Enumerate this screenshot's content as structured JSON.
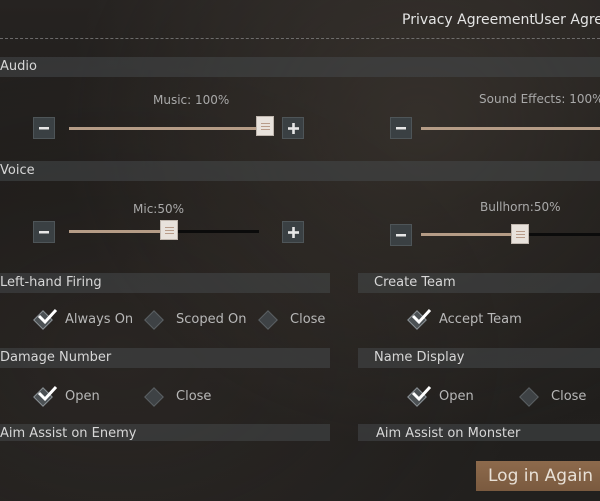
{
  "header": {
    "links": [
      "Privacy Agreement",
      "User Agree"
    ]
  },
  "sections": {
    "audio": "Audio",
    "voice": "Voice",
    "left_hand_firing": "Left-hand Firing",
    "create_team": "Create Team",
    "damage_number": "Damage Number",
    "name_display": "Name Display",
    "aim_assist_enemy": "Aim Assist on Enemy",
    "aim_assist_monster": "Aim Assist on Monster"
  },
  "sliders": {
    "music": {
      "label": "Music:  100%",
      "level": 1.0
    },
    "sound_effects": {
      "label": "Sound Effects:  100%",
      "level": 1.0
    },
    "mic": {
      "label": "Mic:50%",
      "level": 0.5
    },
    "bullhorn": {
      "label": "Bullhorn:50%",
      "level": 0.5
    }
  },
  "options": {
    "left_hand_firing": [
      "Always On",
      "Scoped On",
      "Close"
    ],
    "left_hand_firing_selected": "Always On",
    "create_team": [
      "Accept Team"
    ],
    "create_team_selected": "Accept Team",
    "damage_number": [
      "Open",
      "Close"
    ],
    "damage_number_selected": "Open",
    "name_display": [
      "Open",
      "Close"
    ],
    "name_display_selected": "Open"
  },
  "buttons": {
    "login_again": "Log in Again"
  },
  "icons": [
    "minus-icon",
    "plus-icon",
    "slider-thumb-icon",
    "check-icon",
    "diamond-checkbox-icon"
  ],
  "colors": {
    "accent": "#b59c86",
    "button_brown": "#8d6a4c",
    "section_bar": "#464a4c"
  }
}
